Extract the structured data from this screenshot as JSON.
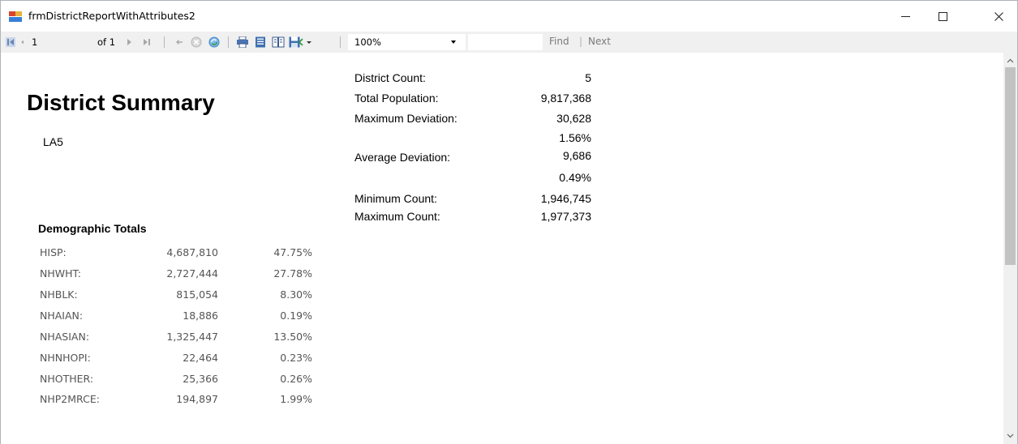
{
  "window": {
    "title": "frmDistrictReportWithAttributes2"
  },
  "toolbar": {
    "current_page": "1",
    "page_of": "of 1",
    "zoom": "100%",
    "find_label": "Find",
    "find_separator": "|",
    "next_label": "Next"
  },
  "report": {
    "title": "District Summary",
    "plan_name": "LA5",
    "stats": [
      {
        "label": "District Count:",
        "value": "5"
      },
      {
        "label": "Total Population:",
        "value": "9,817,368"
      },
      {
        "label": "Maximum Deviation:",
        "value": "30,628"
      },
      {
        "label": "",
        "value": "1.56%"
      },
      {
        "label": "Average Deviation:",
        "value": "9,686"
      },
      {
        "label": "",
        "value": "0.49%"
      },
      {
        "label": "Minimum Count:",
        "value": "1,946,745"
      },
      {
        "label": "Maximum Count:",
        "value": "1,977,373"
      }
    ],
    "demographics_title": "Demographic Totals",
    "demographics": [
      {
        "label": "HISP:",
        "count": "4,687,810",
        "pct": "47.75%"
      },
      {
        "label": "NHWHT:",
        "count": "2,727,444",
        "pct": "27.78%"
      },
      {
        "label": "NHBLK:",
        "count": "815,054",
        "pct": "8.30%"
      },
      {
        "label": "NHAIAN:",
        "count": "18,886",
        "pct": "0.19%"
      },
      {
        "label": "NHASIAN:",
        "count": "1,325,447",
        "pct": "13.50%"
      },
      {
        "label": "NHNHOPI:",
        "count": "22,464",
        "pct": "0.23%"
      },
      {
        "label": "NHOTHER:",
        "count": "25,366",
        "pct": "0.26%"
      },
      {
        "label": "NHP2MRCE:",
        "count": "194,897",
        "pct": "1.99%"
      }
    ]
  }
}
